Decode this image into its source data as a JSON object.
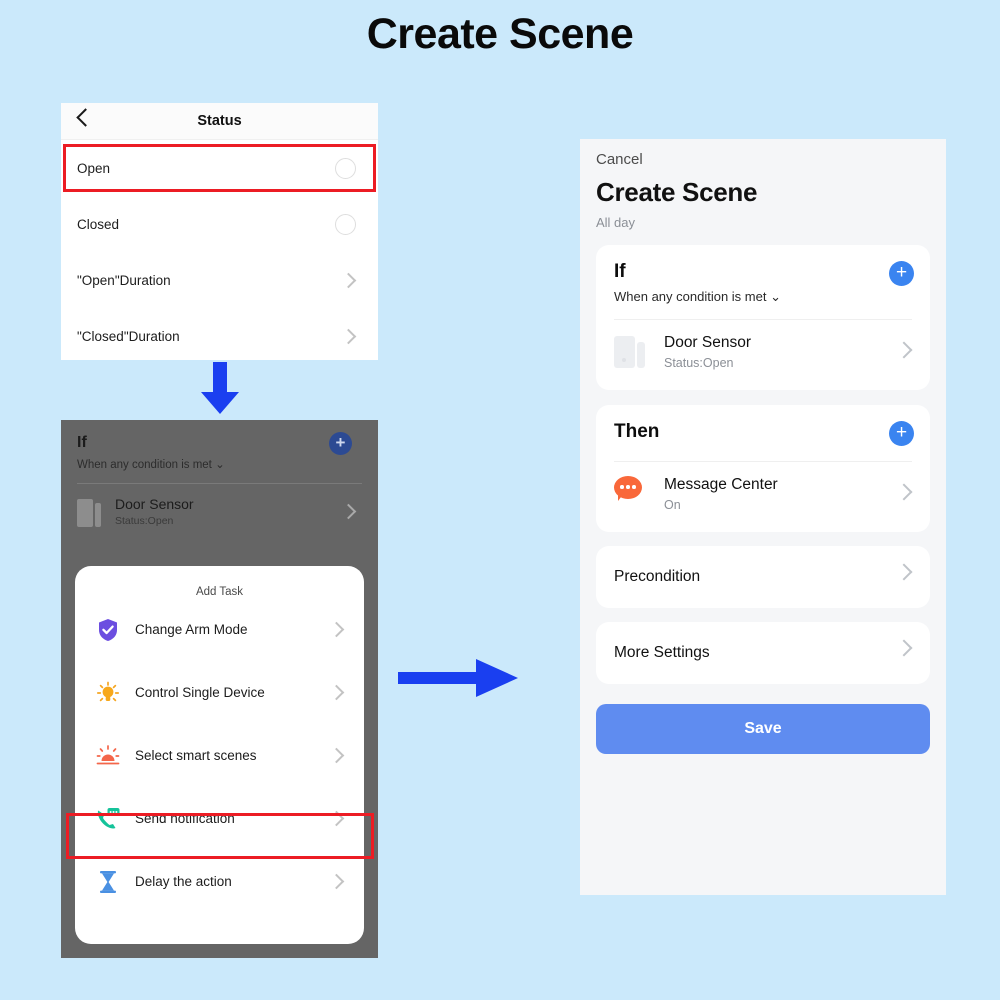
{
  "page": {
    "title": "Create Scene",
    "background_color": "#cbe9fb",
    "accent_blue": "#1a3ff0",
    "highlight_red": "#ec1c24"
  },
  "panel_status": {
    "nav": {
      "back_icon": "chevron-left-icon",
      "title": "Status"
    },
    "rows": [
      {
        "label": "Open",
        "control": "radio",
        "highlighted": true
      },
      {
        "label": "Closed",
        "control": "radio",
        "highlighted": false
      },
      {
        "label": "\"Open\"Duration",
        "control": "chevron",
        "highlighted": false
      },
      {
        "label": "\"Closed\"Duration",
        "control": "chevron",
        "highlighted": false
      }
    ]
  },
  "arrows": {
    "down": "arrow-down-icon",
    "right": "arrow-right-icon"
  },
  "panel_addtask": {
    "if_section": {
      "heading": "If",
      "subtitle": "When any condition is met",
      "dropdown_icon": "chevron-down-icon",
      "add_icon": "plus-icon"
    },
    "device": {
      "name": "Door Sensor",
      "status": "Status:Open",
      "icon": "door-sensor-icon",
      "chevron": "chevron-right-icon"
    },
    "sheet": {
      "title": "Add Task",
      "items": [
        {
          "label": "Change Arm Mode",
          "icon": "shield-check-icon",
          "color": "#6c5ce7",
          "highlighted": false
        },
        {
          "label": "Control Single Device",
          "icon": "lightbulb-icon",
          "color": "#f5a623",
          "highlighted": false
        },
        {
          "label": "Select smart scenes",
          "icon": "sunrise-icon",
          "color": "#f4664a",
          "highlighted": false
        },
        {
          "label": "Send notification",
          "icon": "phone-message-icon",
          "color": "#15c39a",
          "highlighted": true
        },
        {
          "label": "Delay the action",
          "icon": "hourglass-icon",
          "color": "#4a90e2",
          "highlighted": false
        }
      ]
    }
  },
  "panel_create": {
    "cancel_label": "Cancel",
    "title": "Create Scene",
    "subtitle": "All day",
    "if_section": {
      "heading": "If",
      "subtitle": "When any condition is met",
      "dropdown_icon": "chevron-down-icon",
      "add_icon": "plus-icon",
      "device": {
        "name": "Door Sensor",
        "status": "Status:Open",
        "icon": "door-sensor-icon",
        "chevron": "chevron-right-icon"
      }
    },
    "then_section": {
      "heading": "Then",
      "add_icon": "plus-icon",
      "action": {
        "name": "Message Center",
        "status": "On",
        "icon": "message-bubble-icon",
        "chevron": "chevron-right-icon"
      }
    },
    "precondition_label": "Precondition",
    "more_settings_label": "More Settings",
    "save_label": "Save"
  }
}
